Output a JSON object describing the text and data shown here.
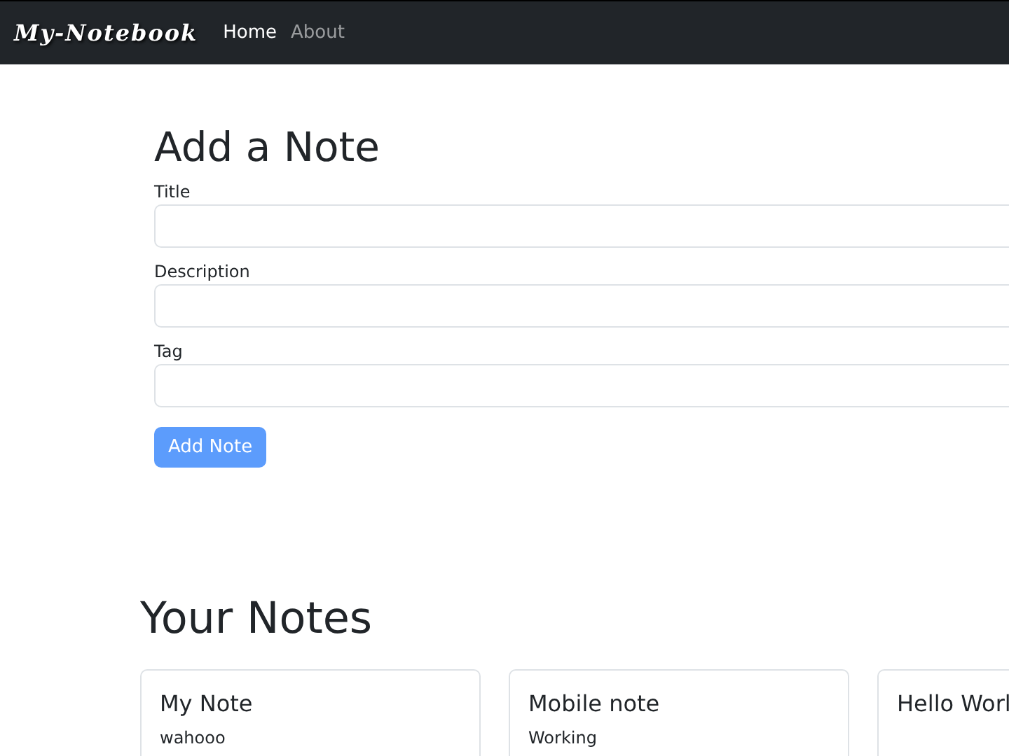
{
  "navbar": {
    "brand": "My-Notebook",
    "links": [
      {
        "label": "Home",
        "selected": true
      },
      {
        "label": "About",
        "selected": false
      }
    ]
  },
  "add_note": {
    "heading": "Add a Note",
    "fields": [
      {
        "label": "Title"
      },
      {
        "label": "Description"
      },
      {
        "label": "Tag"
      }
    ],
    "button": {
      "label": "Add Note",
      "disabled": true
    }
  },
  "notes": {
    "heading": "Your Notes",
    "cards": [
      {
        "title": "My Note",
        "description": "wahooo"
      },
      {
        "title": "Mobile note",
        "description": "Working"
      },
      {
        "title": "Hello Worl"
      }
    ]
  }
}
